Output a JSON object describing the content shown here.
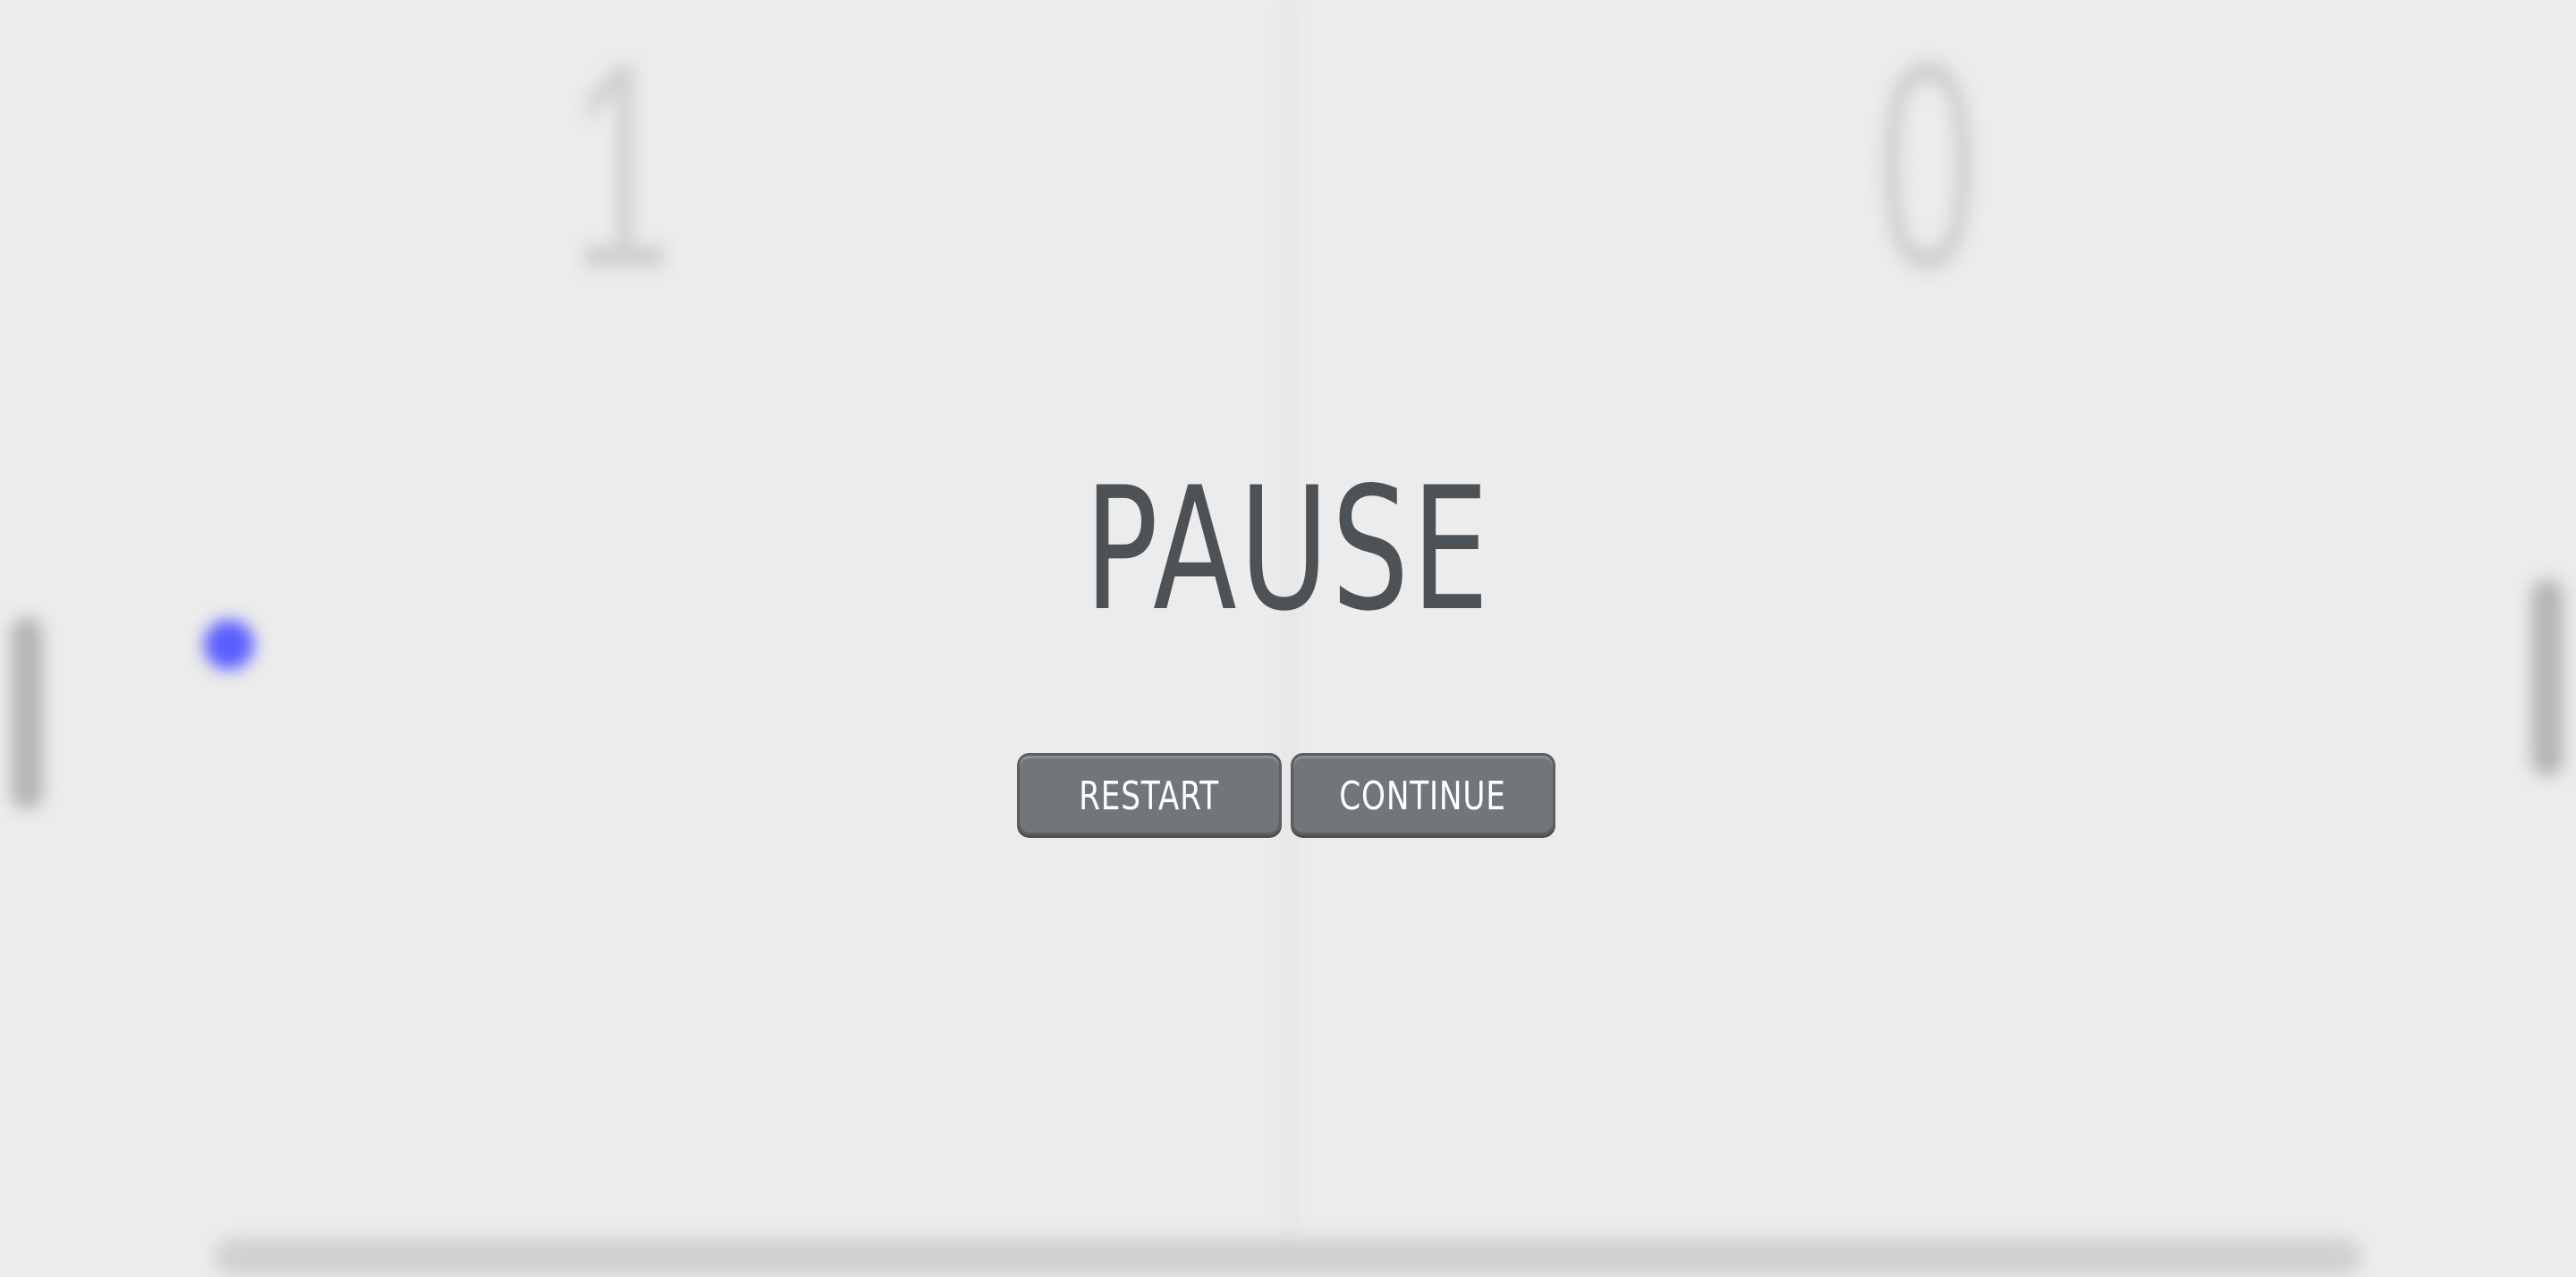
{
  "game": {
    "scores": {
      "left": "1",
      "right": "0"
    },
    "ball_color": "#5a5cff"
  },
  "pause_menu": {
    "title": "PAUSE",
    "restart_label": "RESTART",
    "continue_label": "CONTINUE",
    "button_color": "#71767a",
    "title_color": "#4d5257"
  }
}
